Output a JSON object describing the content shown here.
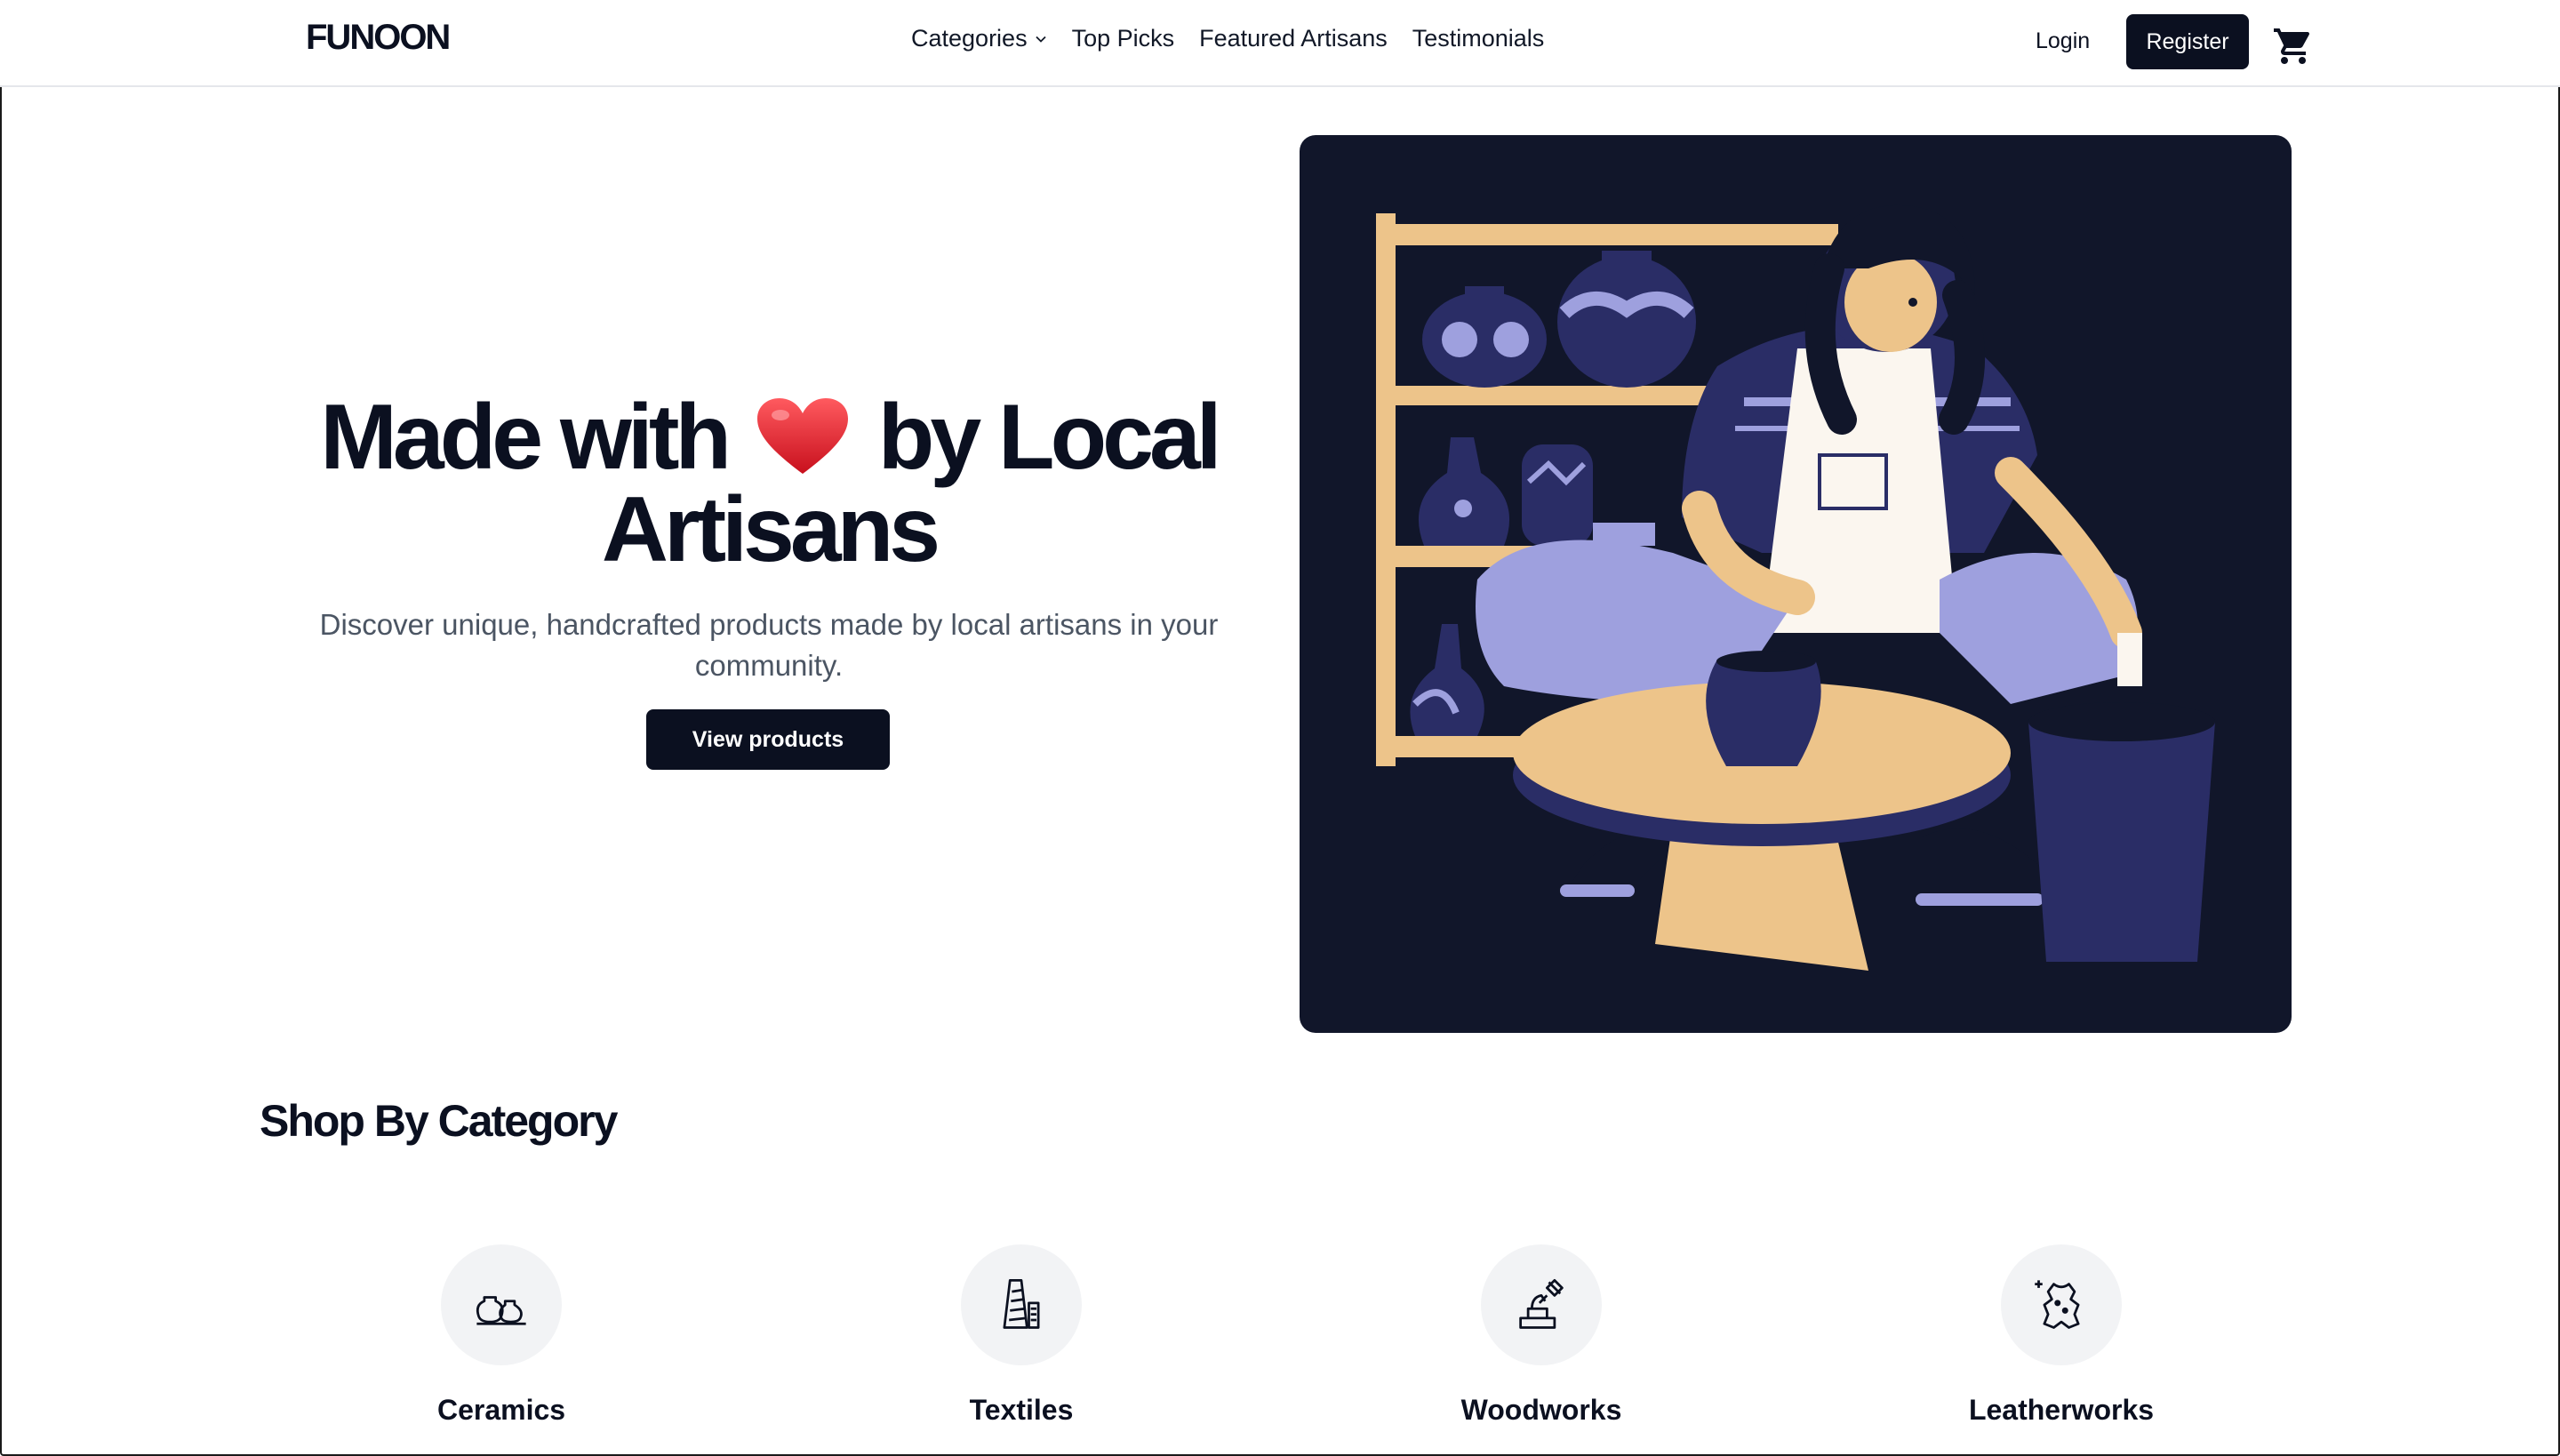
{
  "brand": {
    "logo_text": "FUNOON"
  },
  "nav": {
    "categories_label": "Categories",
    "links": [
      "Top Picks",
      "Featured Artisans",
      "Testimonials"
    ],
    "login_label": "Login",
    "register_label": "Register",
    "cart_icon": "shopping-cart-icon"
  },
  "hero": {
    "title_part1": "Made with",
    "title_emoji": "heart-emoji",
    "title_part2": "by Local",
    "title_line2": "Artisans",
    "subtitle": "Discover unique, handcrafted products made by local artisans in your community.",
    "cta_label": "View products",
    "illustration": "artisan-pottery-illustration"
  },
  "categories": {
    "heading": "Shop By Category",
    "items": [
      {
        "label": "Ceramics",
        "icon": "ceramics-icon"
      },
      {
        "label": "Textiles",
        "icon": "textiles-icon"
      },
      {
        "label": "Woodworks",
        "icon": "woodworks-icon"
      },
      {
        "label": "Leatherworks",
        "icon": "leatherworks-icon"
      }
    ]
  },
  "colors": {
    "primary": "#0b1020",
    "illustration_bg": "#11162a",
    "accent_periwinkle": "#9ea0de",
    "accent_sand": "#edc48a",
    "navy": "#262a5c",
    "category_circle": "#f2f3f5",
    "heart": "#e0242f"
  }
}
